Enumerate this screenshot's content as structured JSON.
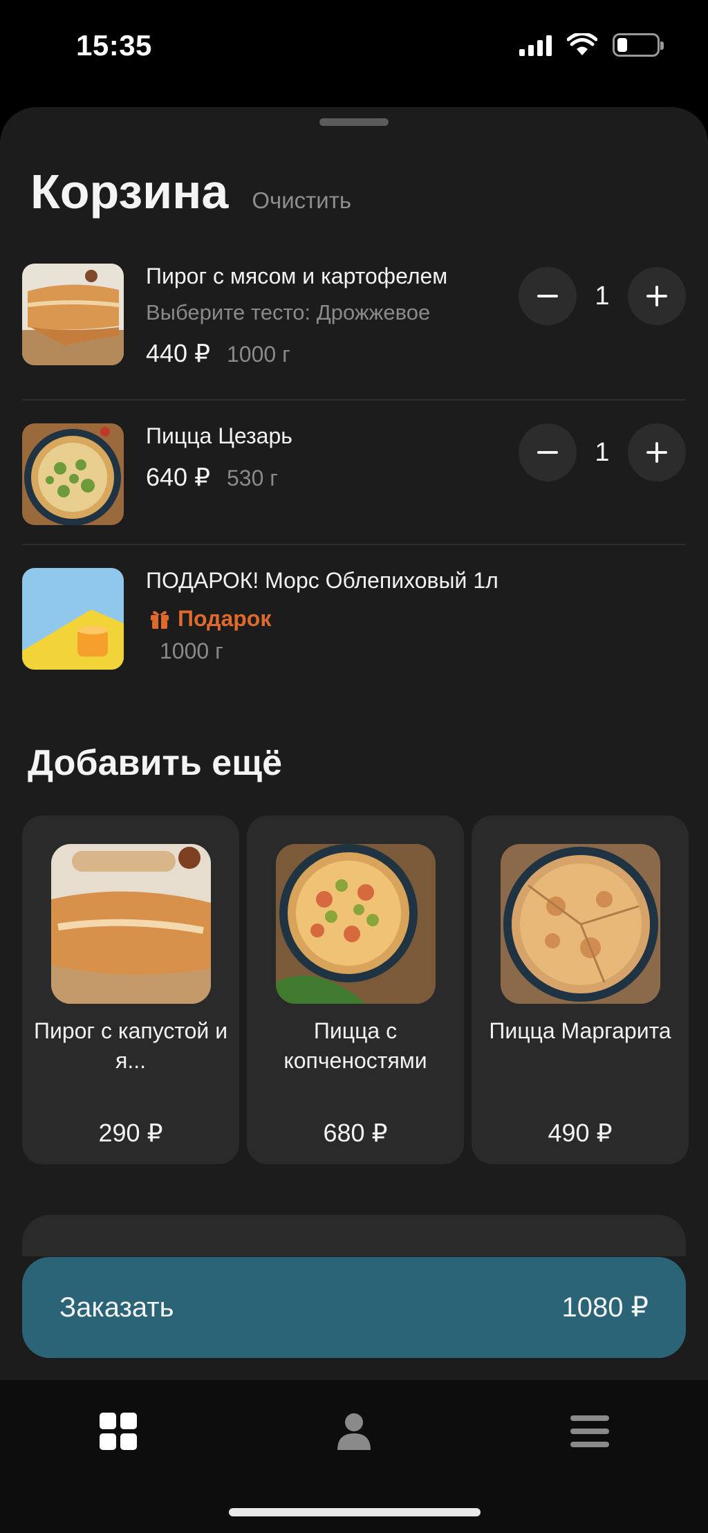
{
  "status_bar": {
    "time": "15:35"
  },
  "cart": {
    "title": "Корзина",
    "clear_label": "Очистить",
    "items": [
      {
        "name": "Пирог с мясом и картофелем",
        "option": "Выберите тесто: Дрожжевое",
        "price": "440 ₽",
        "weight": "1000 г",
        "quantity": "1"
      },
      {
        "name": "Пицца Цезарь",
        "price": "640 ₽",
        "weight": "530 г",
        "quantity": "1"
      },
      {
        "name": "ПОДАРОК! Морс Облепиховый 1л",
        "gift_label": "Подарок",
        "weight": "1000 г"
      }
    ]
  },
  "upsell": {
    "title": "Добавить ещё",
    "cards": [
      {
        "name": "Пирог с капустой и я...",
        "price": "290 ₽"
      },
      {
        "name": "Пицца с копченостями",
        "price": "680 ₽"
      },
      {
        "name": "Пицца Маргарита",
        "price": "490 ₽"
      }
    ]
  },
  "order_button": {
    "label": "Заказать",
    "total": "1080 ₽"
  },
  "tab_bar": {
    "tabs": [
      "grid-icon",
      "profile-icon",
      "menu-icon"
    ]
  },
  "colors": {
    "accent": "#2a6476",
    "gift": "#e06a2b",
    "sheet": "#1c1c1c"
  }
}
